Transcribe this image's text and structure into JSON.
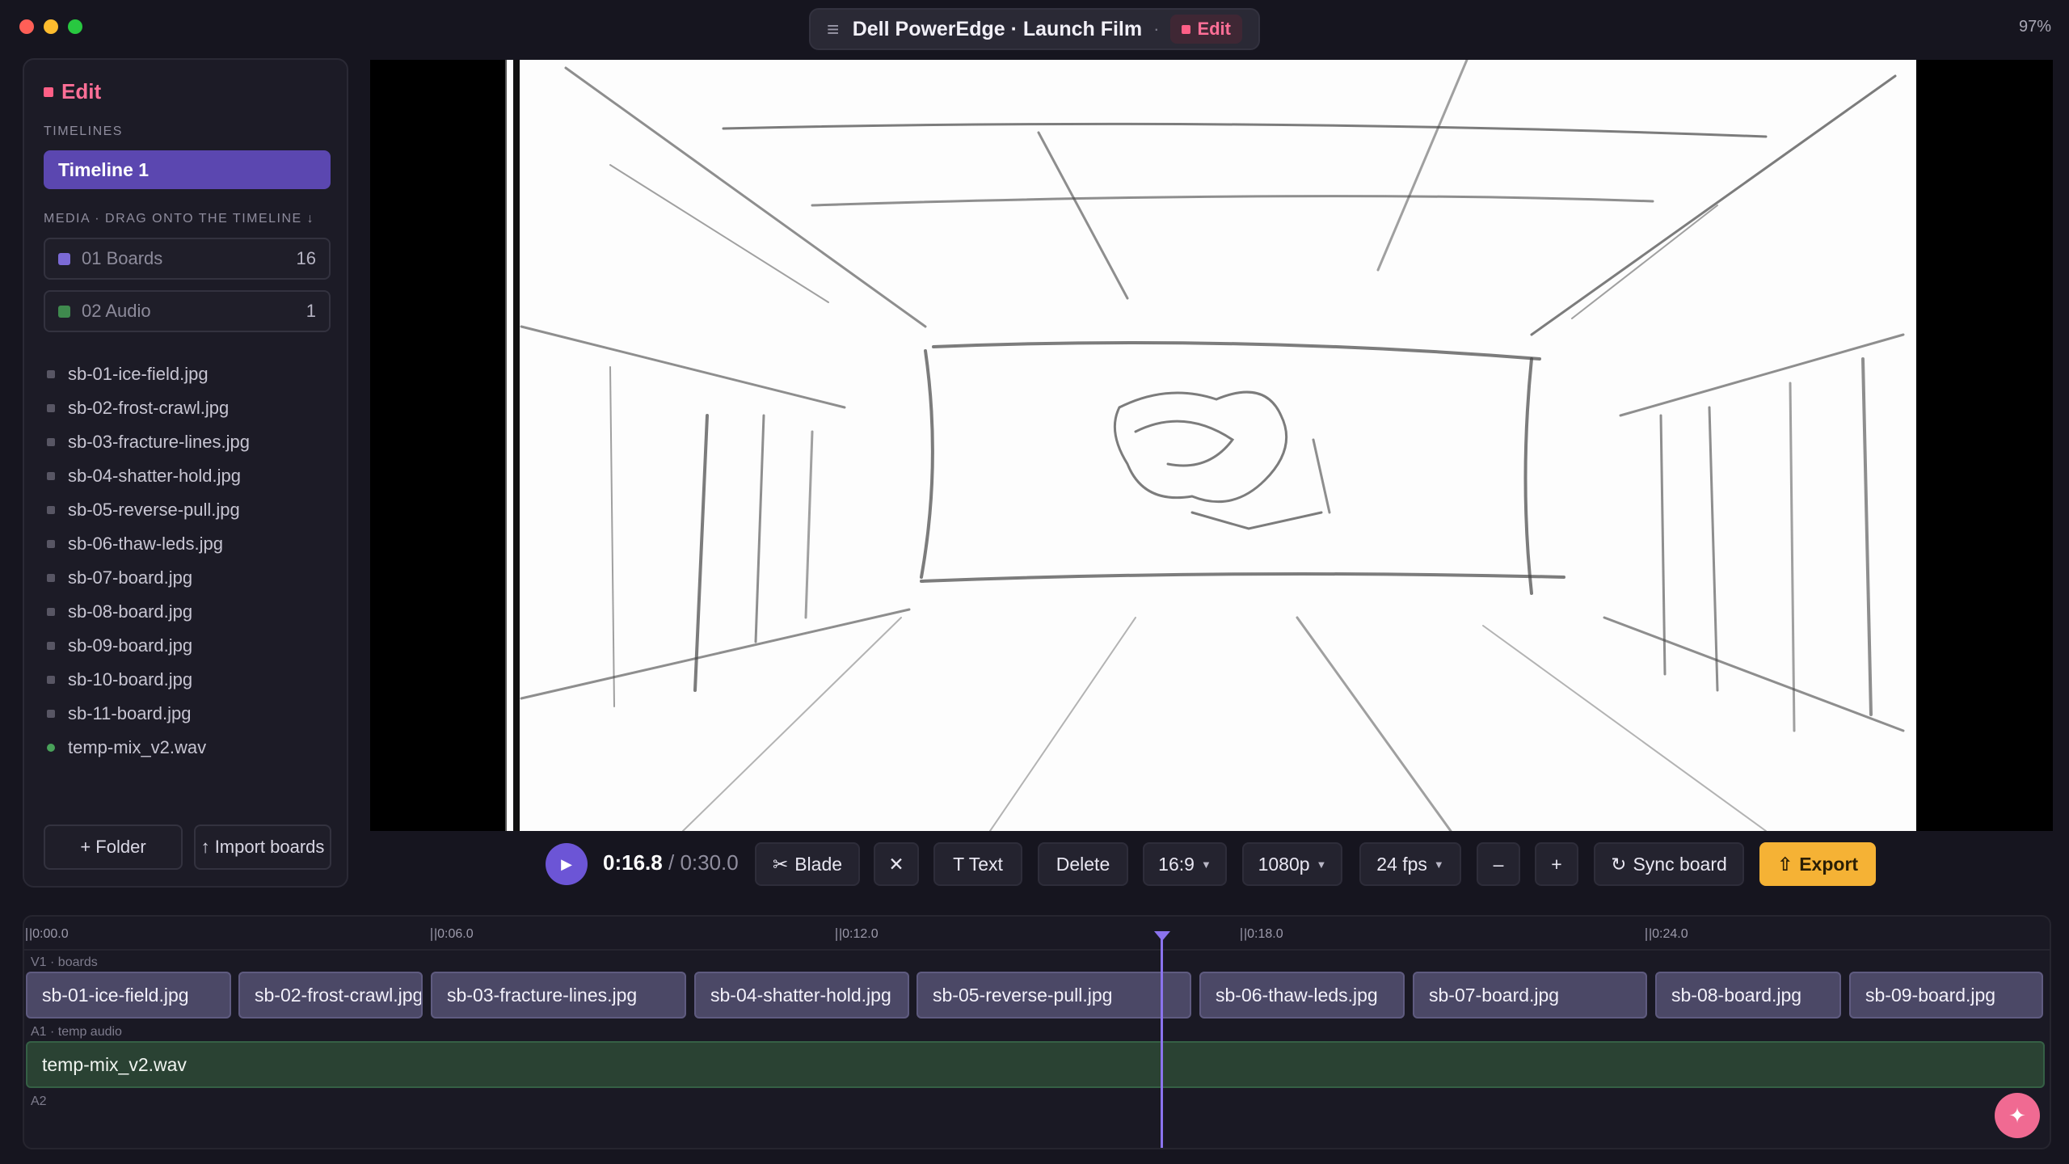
{
  "window": {
    "title": "Dell PowerEdge · Launch Film",
    "title_sep": "·",
    "mode": "Edit",
    "battery": "97%"
  },
  "colors": {
    "accent": "#6c55d6",
    "edit_pink": "#ff5f86",
    "export": "#f5b235",
    "audio_green": "#2a4233"
  },
  "sidebar": {
    "header": "Edit",
    "timelines_heading": "TIMELINES",
    "timelines": [
      "Timeline 1"
    ],
    "media_heading": "MEDIA · DRAG ONTO THE TIMELINE ↓",
    "folders": [
      {
        "name": "01 Boards",
        "count": "16",
        "color": "#7b6ad6"
      },
      {
        "name": "02 Audio",
        "count": "1",
        "color": "#3f8a4e"
      }
    ],
    "files": [
      "sb-01-ice-field.jpg",
      "sb-02-frost-crawl.jpg",
      "sb-03-fracture-lines.jpg",
      "sb-04-shatter-hold.jpg",
      "sb-05-reverse-pull.jpg",
      "sb-06-thaw-leds.jpg",
      "sb-07-board.jpg",
      "sb-08-board.jpg",
      "sb-09-board.jpg",
      "sb-10-board.jpg",
      "sb-11-board.jpg",
      "temp-mix_v2.wav"
    ],
    "add_folder": "+ Folder",
    "import_boards": "↑ Import boards"
  },
  "transport": {
    "current_time": "0:16.8",
    "separator": "/",
    "total_time": "0:30.0",
    "blade": "Blade",
    "close": "✕",
    "text": "T Text",
    "delete": "Delete",
    "aspect": "16:9",
    "resolution": "1080p",
    "fps": "24 fps",
    "zoom_out": "–",
    "zoom_in": "+",
    "sync_board": "Sync board",
    "export": "Export"
  },
  "timeline": {
    "ticks": [
      "|0:00.0",
      "|0:06.0",
      "|0:12.0",
      "|0:18.0",
      "|0:24.0"
    ],
    "tracks": {
      "v1": "V1 · boards",
      "a1": "A1 · temp audio",
      "a2": "A2"
    },
    "video_clips": [
      "sb-01-ice-field.jpg",
      "sb-02-frost-crawl.jpg",
      "sb-03-fracture-lines.jpg",
      "sb-04-shatter-hold.jpg",
      "sb-05-reverse-pull.jpg",
      "sb-06-thaw-leds.jpg",
      "sb-07-board.jpg",
      "sb-08-board.jpg",
      "sb-09-board.jpg"
    ],
    "audio_clip": "temp-mix_v2.wav",
    "playhead_time": "0:16.8"
  }
}
